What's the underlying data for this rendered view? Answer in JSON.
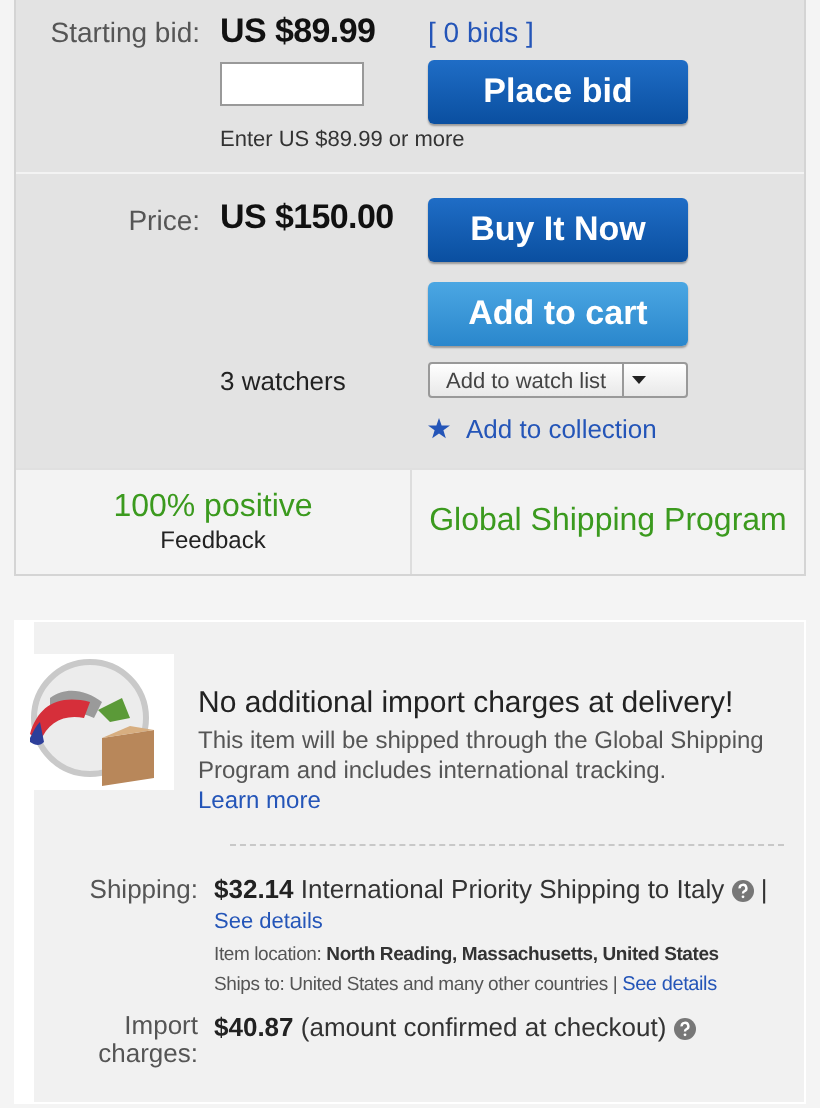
{
  "bid": {
    "label": "Starting bid:",
    "price": "US $89.99",
    "bids_link": "[ 0 bids ]",
    "hint": "Enter US $89.99 or more",
    "button": "Place bid"
  },
  "buy": {
    "label": "Price:",
    "price": "US $150.00",
    "buy_button": "Buy It Now",
    "cart_button": "Add to cart",
    "watchers": "3 watchers",
    "watch_button": "Add to watch list",
    "collection_link": "Add to collection"
  },
  "seller": {
    "feedback": "100% positive",
    "feedback_label": "Feedback",
    "program": "Global Shipping Program"
  },
  "shipping_notice": {
    "title": "No additional import charges at delivery!",
    "text": "This item will be shipped through the Global Shipping Program and includes international tracking.",
    "link": "Learn more"
  },
  "shipping": {
    "label": "Shipping:",
    "cost": "$32.14",
    "service": "International Priority Shipping to Italy",
    "separator": "|",
    "details_link": "See details",
    "location_label": "Item location:",
    "location": "North Reading, Massachusetts, United States",
    "ships_to_label": "Ships to:",
    "ships_to": "United States and many other countries",
    "ships_to_separator": "|",
    "ships_to_link": "See details"
  },
  "import": {
    "label": "Import charges:",
    "cost": "$40.87",
    "note": "(amount confirmed at checkout)"
  }
}
